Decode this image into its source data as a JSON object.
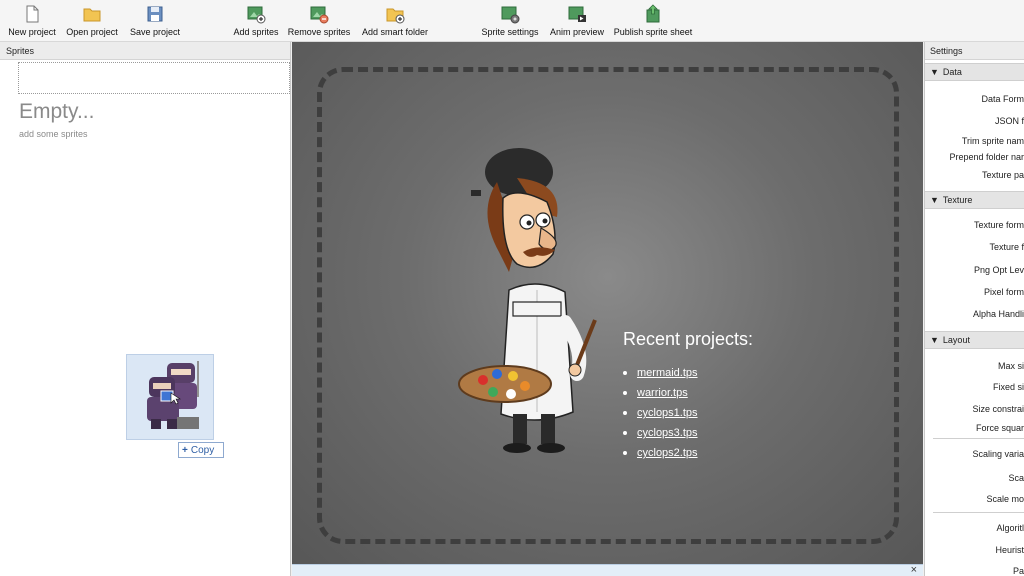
{
  "toolbar": {
    "new_project": "New project",
    "open_project": "Open project",
    "save_project": "Save project",
    "add_sprites": "Add sprites",
    "remove_sprites": "Remove sprites",
    "add_smart_folder": "Add smart folder",
    "sprite_settings": "Sprite settings",
    "anim_preview": "Anim preview",
    "publish_sprite_sheet": "Publish sprite sheet"
  },
  "sprites_panel": {
    "header": "Sprites",
    "empty_title": "Empty...",
    "empty_subtitle": "add some sprites",
    "drag_tooltip": "Copy",
    "drag_tooltip_icon": "plus-icon"
  },
  "center": {
    "recent_title": "Recent projects:",
    "recent_projects": [
      "mermaid.tps",
      "warrior.tps",
      "cyclops1.tps",
      "cyclops3.tps",
      "cyclops2.tps"
    ],
    "close_symbol": "×"
  },
  "settings_panel": {
    "header": "Settings",
    "sections": {
      "data": {
        "title": "Data",
        "rows": [
          "Data Form",
          "JSON f",
          "Trim sprite nam",
          "Prepend folder nar",
          "Texture pa"
        ]
      },
      "texture": {
        "title": "Texture",
        "rows": [
          "Texture form",
          "Texture f",
          "Png Opt Lev",
          "Pixel form",
          "Alpha Handli"
        ]
      },
      "layout": {
        "title": "Layout",
        "rows": [
          "Max si",
          "Fixed si",
          "Size constrai",
          "Force squar",
          "Scaling varia",
          "Sca",
          "Scale mo",
          "Algoritl",
          "Heurist",
          "Pa"
        ]
      }
    }
  },
  "colors": {
    "center_bg": "#6d6d6d",
    "dash_frame": "#3e3e3e",
    "accent_blue": "#2f5fa5"
  }
}
